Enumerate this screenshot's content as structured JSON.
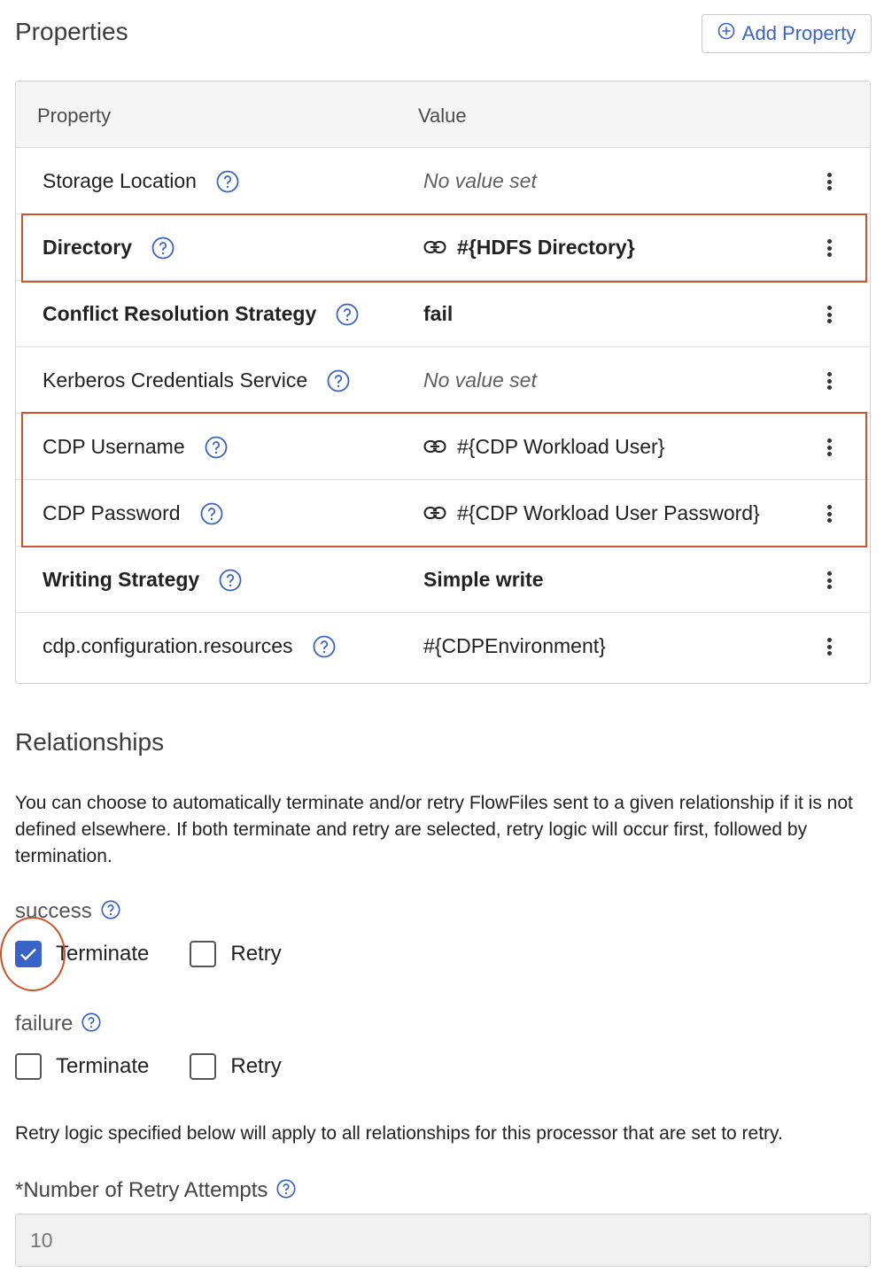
{
  "properties": {
    "title": "Properties",
    "add_button_label": "Add Property",
    "columns": {
      "property": "Property",
      "value": "Value"
    },
    "rows": [
      {
        "name": "Storage Location",
        "value": "No value set"
      },
      {
        "name": "Directory",
        "value": "#{HDFS Directory}"
      },
      {
        "name": "Conflict Resolution Strategy",
        "value": "fail"
      },
      {
        "name": "Kerberos Credentials Service",
        "value": "No value set"
      },
      {
        "name": "CDP Username",
        "value": "#{CDP Workload User}"
      },
      {
        "name": "CDP Password",
        "value": "#{CDP Workload User Password}"
      },
      {
        "name": "Writing Strategy",
        "value": "Simple write"
      },
      {
        "name": "cdp.configuration.resources",
        "value": "#{CDPEnvironment}"
      }
    ]
  },
  "relationships": {
    "title": "Relationships",
    "description": "You can choose to automatically terminate and/or retry FlowFiles sent to a given relationship if it is not defined elsewhere. If both terminate and retry are selected, retry logic will occur first, followed by termination.",
    "items": [
      {
        "name": "success",
        "terminate_label": "Terminate",
        "terminate_checked": true,
        "retry_label": "Retry",
        "retry_checked": false
      },
      {
        "name": "failure",
        "terminate_label": "Terminate",
        "terminate_checked": false,
        "retry_label": "Retry",
        "retry_checked": false
      }
    ],
    "retry_note": "Retry logic specified below will apply to all relationships for this processor that are set to retry."
  },
  "retry_attempts": {
    "label": "*Number of Retry Attempts",
    "placeholder": "10"
  },
  "colors": {
    "accent": "#3a63c8",
    "highlight": "#c8562c"
  }
}
